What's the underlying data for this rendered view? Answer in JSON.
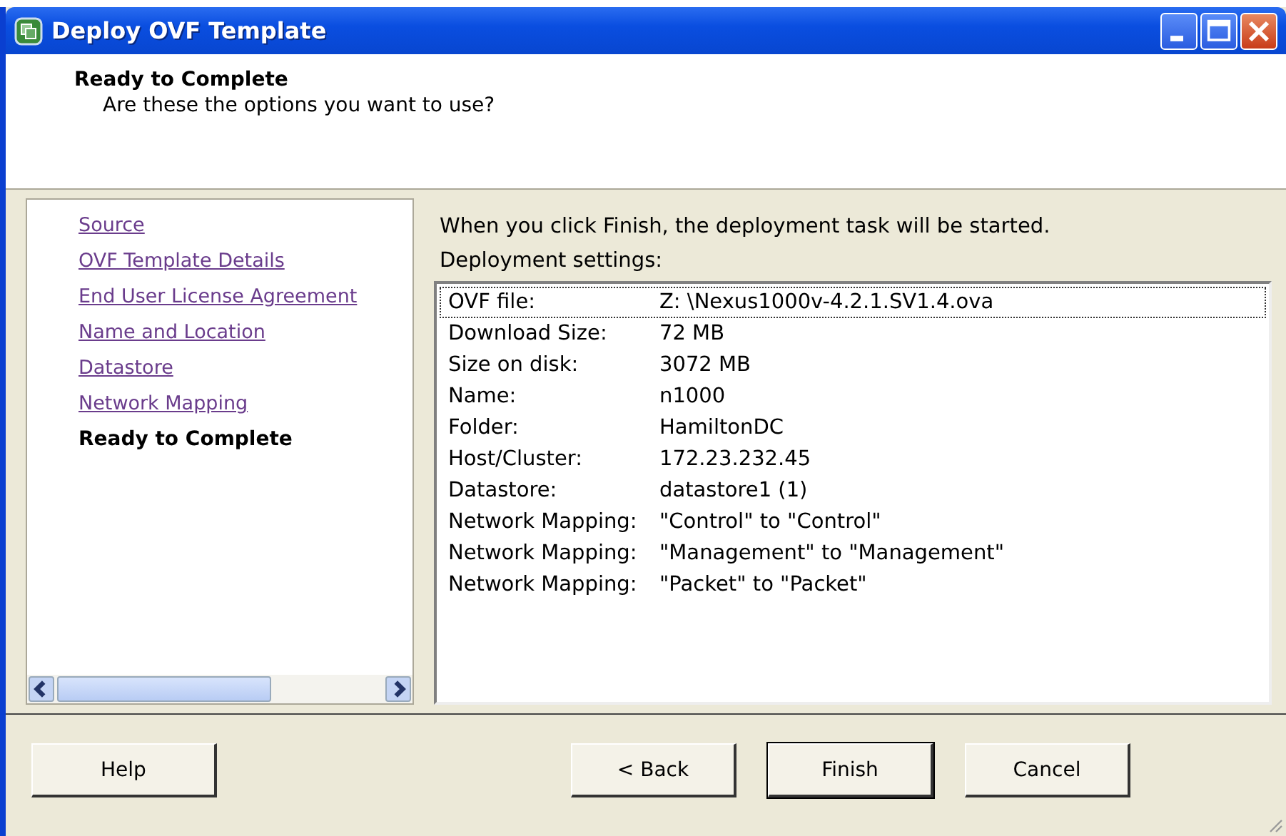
{
  "window": {
    "title": "Deploy OVF Template"
  },
  "header": {
    "title": "Ready to Complete",
    "subtitle": "Are these the options you want to use?"
  },
  "steps": [
    {
      "label": "Source",
      "selected": false
    },
    {
      "label": "OVF Template Details",
      "selected": false
    },
    {
      "label": "End User License Agreement",
      "selected": false
    },
    {
      "label": "Name and Location",
      "selected": false
    },
    {
      "label": "Datastore",
      "selected": false
    },
    {
      "label": "Network Mapping",
      "selected": false
    },
    {
      "label": "Ready to Complete",
      "selected": true
    }
  ],
  "intro": "When you click Finish, the deployment task will be started.",
  "settings_label": "Deployment settings:",
  "settings": [
    {
      "label": "OVF file:",
      "value": "Z: \\Nexus1000v-4.2.1.SV1.4.ova",
      "selected": true
    },
    {
      "label": "Download Size:",
      "value": "72 MB",
      "selected": false
    },
    {
      "label": "Size on disk:",
      "value": "3072 MB",
      "selected": false
    },
    {
      "label": "Name:",
      "value": "n1000",
      "selected": false
    },
    {
      "label": "Folder:",
      "value": "HamiltonDC",
      "selected": false
    },
    {
      "label": "Host/Cluster:",
      "value": "172.23.232.45",
      "selected": false
    },
    {
      "label": "Datastore:",
      "value": "datastore1 (1)",
      "selected": false
    },
    {
      "label": "Network Mapping:",
      "value": "\"Control\" to \"Control\"",
      "selected": false
    },
    {
      "label": "Network Mapping:",
      "value": "\"Management\" to \"Management\"",
      "selected": false
    },
    {
      "label": "Network Mapping:",
      "value": "\"Packet\" to \"Packet\"",
      "selected": false
    }
  ],
  "buttons": [
    {
      "label": "Help",
      "kind": "help",
      "default": false
    },
    {
      "label": "< Back",
      "kind": "nav",
      "default": false
    },
    {
      "label": "Finish",
      "kind": "nav",
      "default": true
    },
    {
      "label": "Cancel",
      "kind": "nav",
      "default": false
    }
  ]
}
